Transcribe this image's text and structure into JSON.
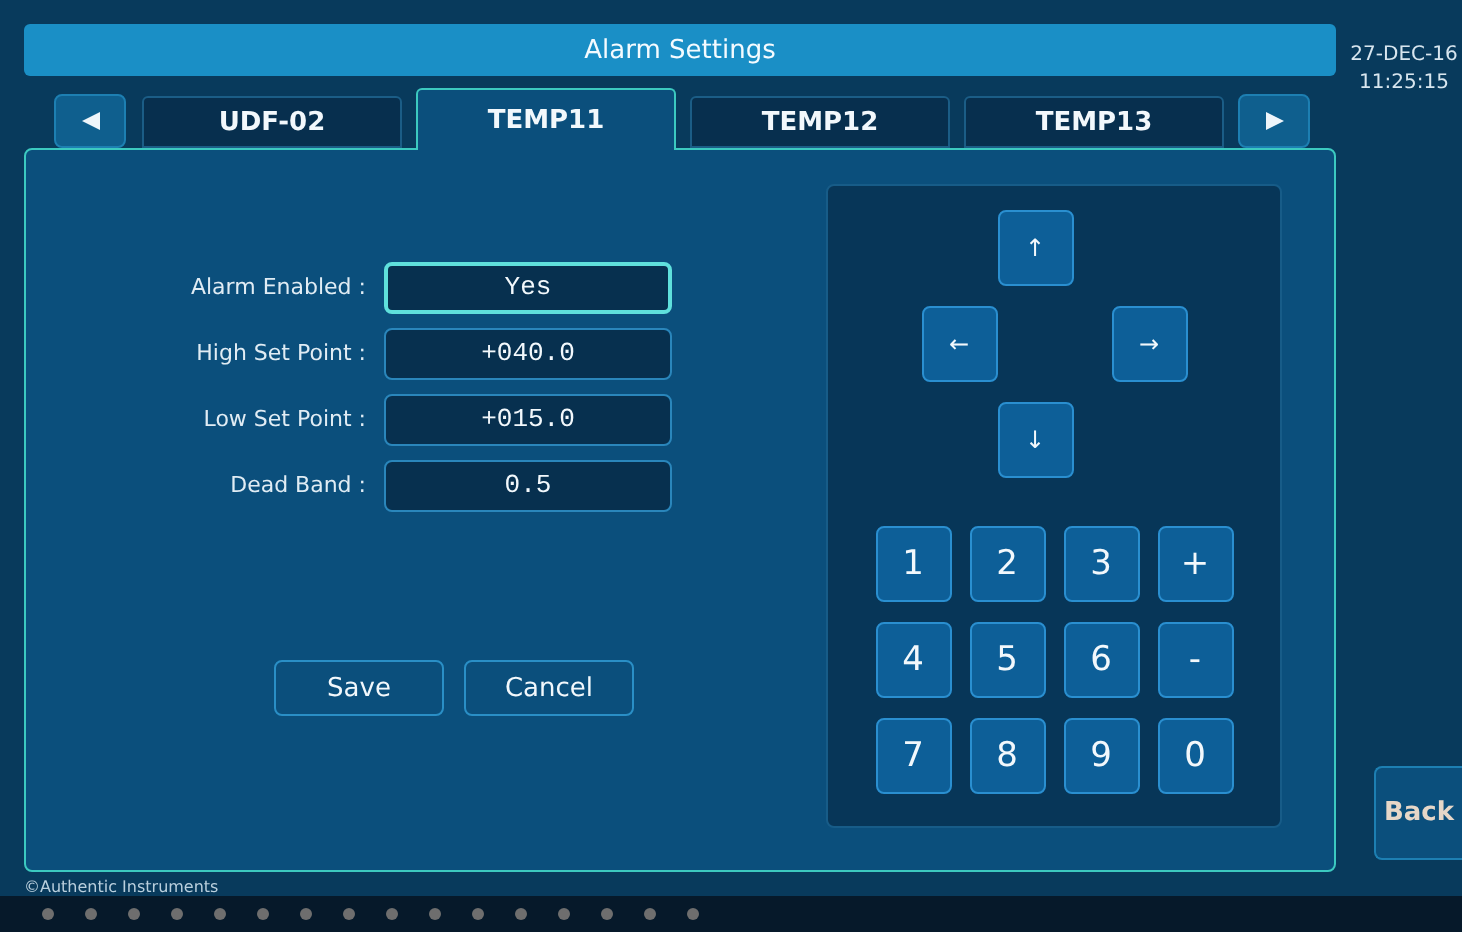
{
  "window": {
    "title": "Alarm Settings"
  },
  "clock": {
    "date": "27-DEC-16",
    "time": "11:25:15"
  },
  "tabs": [
    {
      "label": "UDF-02",
      "selected": false
    },
    {
      "label": "TEMP11",
      "selected": true
    },
    {
      "label": "TEMP12",
      "selected": false
    },
    {
      "label": "TEMP13",
      "selected": false
    }
  ],
  "fields": [
    {
      "label": "Alarm Enabled :",
      "value": "Yes",
      "selected": true
    },
    {
      "label": "High Set Point :",
      "value": "+040.0",
      "selected": false
    },
    {
      "label": "Low Set Point :",
      "value": "+015.0",
      "selected": false
    },
    {
      "label": "Dead Band :",
      "value": "0.5",
      "selected": false
    }
  ],
  "buttons": [
    "Save",
    "Cancel"
  ],
  "keypad": {
    "arrows": {
      "up": "↑",
      "left": "←",
      "right": "→",
      "down": "↓"
    },
    "keys": [
      "1",
      "2",
      "3",
      "+",
      "4",
      "5",
      "6",
      "-",
      "7",
      "8",
      "9",
      "0"
    ]
  },
  "back_button": "Back",
  "copyright": "©Authentic Instruments"
}
